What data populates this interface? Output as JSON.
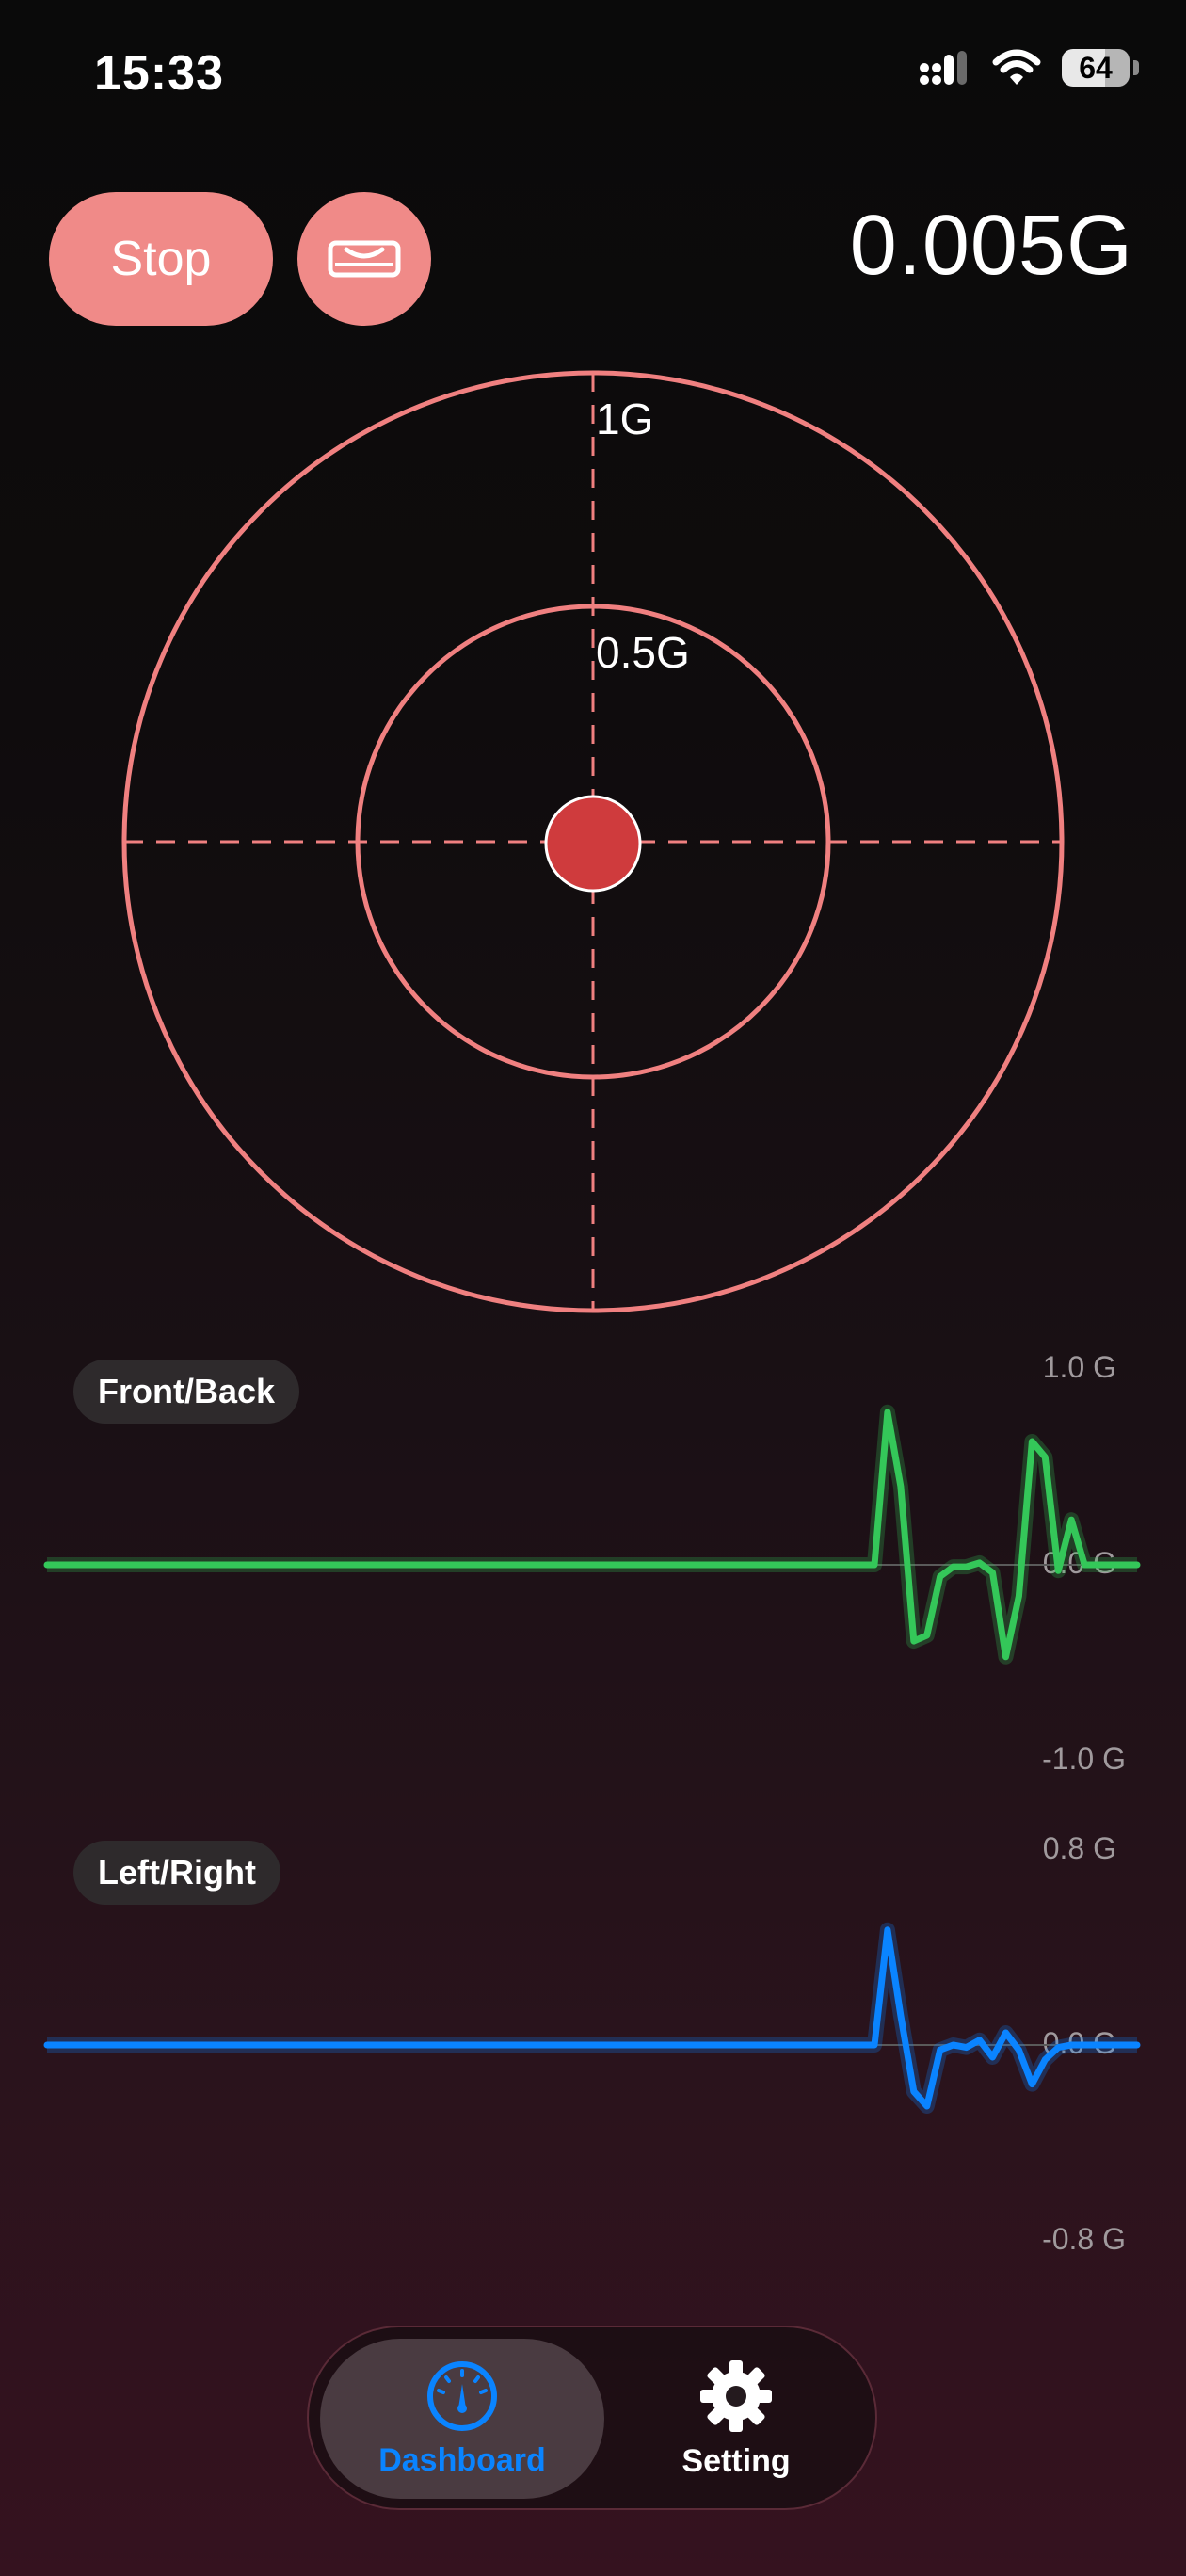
{
  "status_bar": {
    "time": "15:33",
    "battery": "64"
  },
  "controls": {
    "stop_label": "Stop",
    "level_icon": "level-icon",
    "gforce_readout": "0.005G"
  },
  "target": {
    "outer_label": "1G",
    "inner_label": "0.5G"
  },
  "charts": {
    "front_back": {
      "label": "Front/Back",
      "ticks": {
        "top": "1.0 G",
        "mid": "0.0 G",
        "bottom": "-1.0 G"
      },
      "color": "#34c759",
      "range": [
        -1.0,
        1.0
      ]
    },
    "left_right": {
      "label": "Left/Right",
      "ticks": {
        "top": "0.8 G",
        "mid": "0.0 G",
        "bottom": "-0.8 G"
      },
      "color": "#0a84ff",
      "range": [
        -0.8,
        0.8
      ]
    }
  },
  "chart_data": [
    {
      "type": "line",
      "series": [
        {
          "name": "Front/Back",
          "values": [
            0,
            0,
            0,
            0,
            0,
            0,
            0,
            0,
            0,
            0,
            0,
            0,
            0,
            0,
            0,
            0,
            0,
            0,
            0,
            0,
            0,
            0,
            0,
            0,
            0,
            0,
            0,
            0,
            0,
            0,
            0,
            0,
            0,
            0,
            0,
            0,
            0,
            0,
            0,
            0,
            0,
            0,
            0,
            0,
            0,
            0,
            0,
            0,
            0,
            0,
            0,
            0,
            0,
            0,
            0,
            0,
            0,
            0,
            0,
            0,
            0,
            0,
            0,
            0.0,
            0.78,
            0.4,
            -0.39,
            -0.36,
            -0.06,
            -0.01,
            -0.01,
            0.01,
            -0.04,
            -0.47,
            -0.16,
            0.63,
            0.55,
            -0.03,
            0.23,
            0.0,
            0.0,
            0.0,
            0.0,
            0.0
          ]
        }
      ],
      "ylim": [
        -1.0,
        1.0
      ]
    },
    {
      "type": "line",
      "series": [
        {
          "name": "Left/Right",
          "values": [
            0,
            0,
            0,
            0,
            0,
            0,
            0,
            0,
            0,
            0,
            0,
            0,
            0,
            0,
            0,
            0,
            0,
            0,
            0,
            0,
            0,
            0,
            0,
            0,
            0,
            0,
            0,
            0,
            0,
            0,
            0,
            0,
            0,
            0,
            0,
            0,
            0,
            0,
            0,
            0,
            0,
            0,
            0,
            0,
            0,
            0,
            0,
            0,
            0,
            0,
            0,
            0,
            0,
            0,
            0,
            0,
            0,
            0,
            0,
            0,
            0,
            0,
            0,
            0.0,
            0.47,
            0.12,
            -0.19,
            -0.25,
            -0.02,
            0.0,
            -0.01,
            0.02,
            -0.05,
            0.05,
            -0.02,
            -0.16,
            -0.06,
            -0.01,
            0.0,
            0.0,
            0.0,
            0.0,
            0.0,
            0.0
          ]
        }
      ],
      "ylim": [
        -0.8,
        0.8
      ]
    }
  ],
  "tabbar": {
    "dashboard": {
      "label": "Dashboard",
      "icon": "gauge-icon",
      "color": "#0a84ff"
    },
    "setting": {
      "label": "Setting",
      "icon": "gear-icon"
    }
  }
}
